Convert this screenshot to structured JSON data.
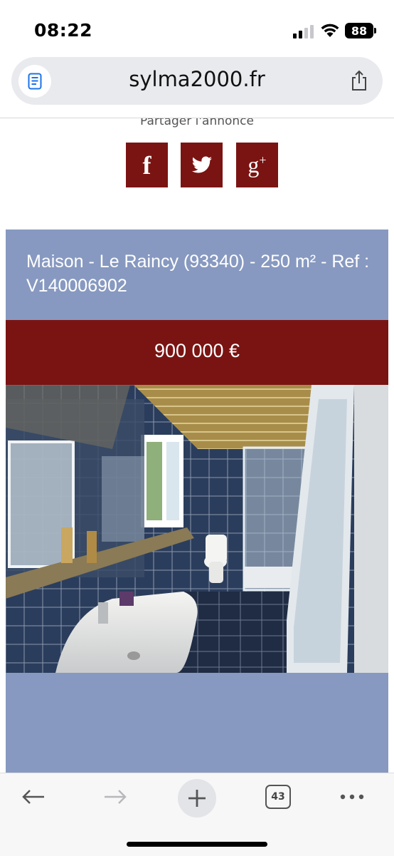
{
  "status": {
    "time": "08:22",
    "battery": "88"
  },
  "browser": {
    "url": "sylma2000.fr",
    "tab_count": "43"
  },
  "share": {
    "label": "Partager l'annonce",
    "buttons": [
      "facebook",
      "twitter",
      "google-plus"
    ]
  },
  "listing": {
    "title": "Maison - Le Raincy (93340) - 250 m² - Ref : V140006902",
    "price": "900 000 €"
  },
  "colors": {
    "brand_red": "#7a1412",
    "header_blue": "#8799c0"
  },
  "icons": {
    "reader": "reader-mode-icon",
    "share": "share-icon",
    "back": "back-arrow-icon",
    "forward": "forward-arrow-icon",
    "new_tab": "plus-icon",
    "tabs": "tabs-icon",
    "more": "more-icon"
  }
}
